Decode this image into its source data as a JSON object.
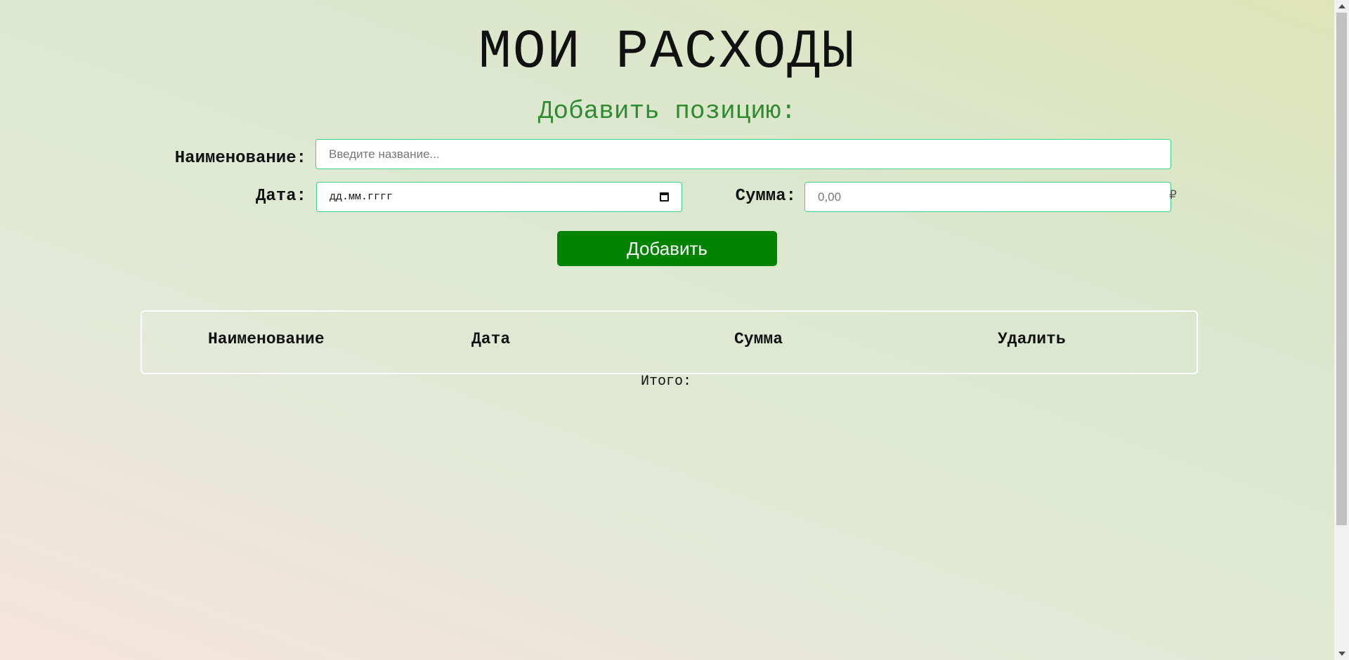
{
  "header": {
    "title": "МОИ РАСХОДЫ",
    "subtitle": "Добавить позицию:"
  },
  "form": {
    "name_label": "Наименование:",
    "name_placeholder": "Введите название...",
    "date_label": "Дата:",
    "date_placeholder": "дд.мм.гггг",
    "sum_label": "Сумма:",
    "sum_placeholder": "0,00",
    "currency_symbol": "₽",
    "add_button_label": "Добавить"
  },
  "table": {
    "columns": [
      "Наименование",
      "Дата",
      "Сумма",
      "Удалить"
    ],
    "rows": []
  },
  "summary": {
    "total_label": "Итого:"
  },
  "colors": {
    "accent": "#028402",
    "subtitle": "#2e8b2e",
    "input_border": "#3ad686"
  }
}
